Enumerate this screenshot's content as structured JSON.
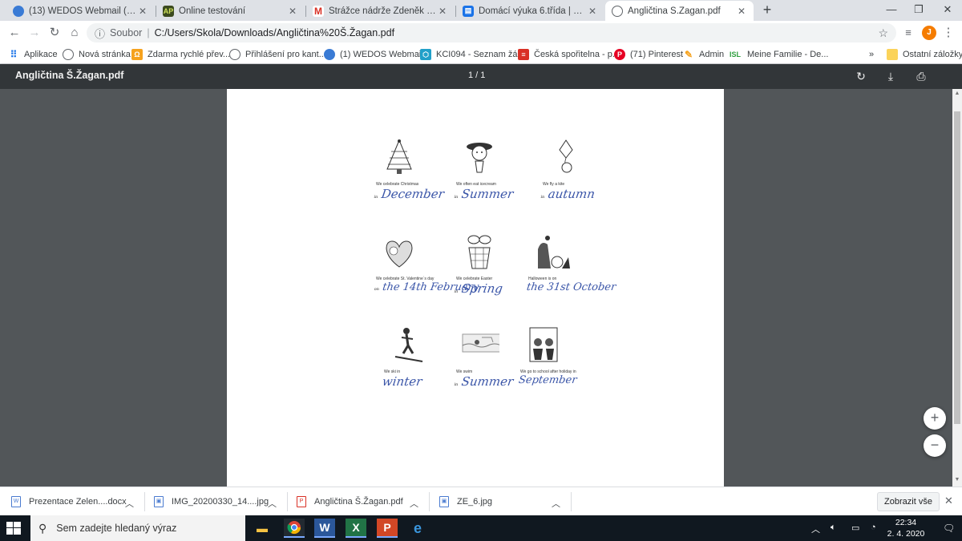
{
  "tabs": [
    {
      "title": "(13) WEDOS Webmail (wes1) :: Re",
      "icon": "wedos-icon",
      "active": false
    },
    {
      "title": "Online testování",
      "icon": "ap-icon",
      "active": false
    },
    {
      "title": "Strážce nádrže Zdeněk Svěrák - b",
      "icon": "gmail-icon",
      "active": false
    },
    {
      "title": "Domácí výuka 6.třída | Základní a",
      "icon": "book-icon",
      "active": false
    },
    {
      "title": "Angličtina Š.Žagan.pdf",
      "icon": "globe-icon",
      "active": true
    }
  ],
  "address": {
    "scheme": "Soubor",
    "url": "C:/Users/Skola/Downloads/Angličtina%20Š.Žagan.pdf"
  },
  "profile_initial": "J",
  "bookmarks": [
    {
      "label": "Aplikace",
      "icon": "apps-grid-icon"
    },
    {
      "label": "Nová stránka",
      "icon": "globe-icon"
    },
    {
      "label": "Zdarma rychlé přev...",
      "icon": "translate-icon"
    },
    {
      "label": "Přihlášení pro kant...",
      "icon": "globe-icon"
    },
    {
      "label": "(1) WEDOS Webmai...",
      "icon": "wedos-icon"
    },
    {
      "label": "KCI094 - Seznam žá...",
      "icon": "kci-icon"
    },
    {
      "label": "Česká spořitelna - p...",
      "icon": "bank-icon"
    },
    {
      "label": "(71) Pinterest",
      "icon": "pinterest-icon"
    },
    {
      "label": "Admin",
      "icon": "pencil-icon"
    },
    {
      "label": "Meine Familie - De...",
      "icon": "isl-icon"
    }
  ],
  "bookmarks_overflow": "»",
  "other_bookmarks": "Ostatní záložky",
  "pdf": {
    "title": "Angličtina Š.Žagan.pdf",
    "page_indicator": "1 / 1"
  },
  "worksheet": {
    "items": [
      {
        "caption": "We celebrate Christmas",
        "pre": "in",
        "answer": "December",
        "picture": "christmas-tree"
      },
      {
        "caption": "We often eat icecream",
        "pre": "in",
        "answer": "Summer",
        "picture": "child-icecream"
      },
      {
        "caption": "We fly a kite",
        "pre": "in",
        "answer": "autumn",
        "picture": "kite"
      },
      {
        "caption": "We celebrate St. Valentine´s day",
        "pre": "on",
        "answer": "the 14th February",
        "picture": "valentine-heart"
      },
      {
        "caption": "We celebrate Easter",
        "pre": "in",
        "answer": "Spring",
        "picture": "easter-basket"
      },
      {
        "caption": "Halloween is on",
        "pre": "",
        "answer": "the 31st October",
        "picture": "halloween"
      },
      {
        "caption": "We ski in",
        "pre": "",
        "answer": "winter",
        "picture": "skier"
      },
      {
        "caption": "We swim",
        "pre": "in",
        "answer": "Summer",
        "picture": "swimming"
      },
      {
        "caption": "We go to school after holiday in",
        "pre": "",
        "answer": "September",
        "picture": "school"
      }
    ]
  },
  "downloads": [
    {
      "name": "Prezentace Zelen....docx",
      "type": "docx"
    },
    {
      "name": "IMG_20200330_14....jpg",
      "type": "jpg"
    },
    {
      "name": "Angličtina Š.Žagan.pdf",
      "type": "pdf"
    },
    {
      "name": "ZE_6.jpg",
      "type": "jpg"
    }
  ],
  "show_all": "Zobrazit vše",
  "taskbar": {
    "search_placeholder": "Sem zadejte hledaný výraz",
    "time": "22:34",
    "date": "2. 4. 2020"
  }
}
